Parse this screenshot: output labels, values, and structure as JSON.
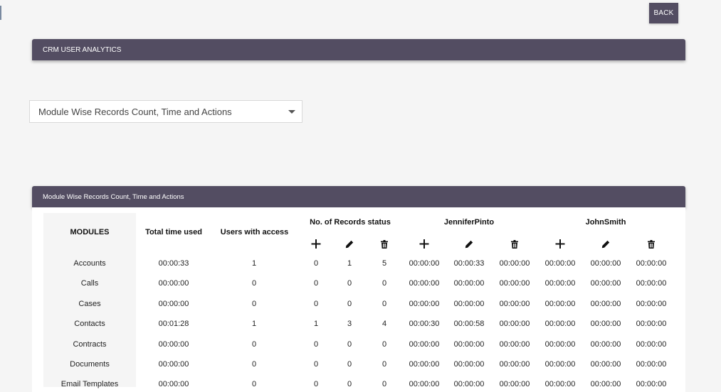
{
  "header": {
    "back_label": "BACK",
    "panel_title": "CRM USER ANALYTICS"
  },
  "filter": {
    "selected": "Module Wise Records Count, Time and Actions"
  },
  "table_panel": {
    "title": "Module Wise Records Count, Time and Actions",
    "col_modules": "MODULES",
    "col_total_time": "Total time used",
    "col_users_access": "Users with access",
    "group_records": "No. of Records status",
    "users": [
      "JenniferPinto",
      "JohnSmith"
    ],
    "action_icons": [
      "plus-icon",
      "pencil-icon",
      "trash-icon"
    ],
    "rows": [
      {
        "module": "Accounts",
        "total": "00:00:33",
        "access": "1",
        "add": "0",
        "edit": "1",
        "del": "5",
        "u1": [
          "00:00:00",
          "00:00:33",
          "00:00:00"
        ],
        "u2": [
          "00:00:00",
          "00:00:00",
          "00:00:00"
        ]
      },
      {
        "module": "Calls",
        "total": "00:00:00",
        "access": "0",
        "add": "0",
        "edit": "0",
        "del": "0",
        "u1": [
          "00:00:00",
          "00:00:00",
          "00:00:00"
        ],
        "u2": [
          "00:00:00",
          "00:00:00",
          "00:00:00"
        ]
      },
      {
        "module": "Cases",
        "total": "00:00:00",
        "access": "0",
        "add": "0",
        "edit": "0",
        "del": "0",
        "u1": [
          "00:00:00",
          "00:00:00",
          "00:00:00"
        ],
        "u2": [
          "00:00:00",
          "00:00:00",
          "00:00:00"
        ]
      },
      {
        "module": "Contacts",
        "total": "00:01:28",
        "access": "1",
        "add": "1",
        "edit": "3",
        "del": "4",
        "u1": [
          "00:00:30",
          "00:00:58",
          "00:00:00"
        ],
        "u2": [
          "00:00:00",
          "00:00:00",
          "00:00:00"
        ]
      },
      {
        "module": "Contracts",
        "total": "00:00:00",
        "access": "0",
        "add": "0",
        "edit": "0",
        "del": "0",
        "u1": [
          "00:00:00",
          "00:00:00",
          "00:00:00"
        ],
        "u2": [
          "00:00:00",
          "00:00:00",
          "00:00:00"
        ]
      },
      {
        "module": "Documents",
        "total": "00:00:00",
        "access": "0",
        "add": "0",
        "edit": "0",
        "del": "0",
        "u1": [
          "00:00:00",
          "00:00:00",
          "00:00:00"
        ],
        "u2": [
          "00:00:00",
          "00:00:00",
          "00:00:00"
        ]
      },
      {
        "module": "Email Templates",
        "total": "00:00:00",
        "access": "0",
        "add": "0",
        "edit": "0",
        "del": "0",
        "u1": [
          "00:00:00",
          "00:00:00",
          "00:00:00"
        ],
        "u2": [
          "00:00:00",
          "00:00:00",
          "00:00:00"
        ]
      }
    ]
  },
  "colors": {
    "header_bg": "#534d62",
    "page_bg": "#f5f5f5"
  }
}
